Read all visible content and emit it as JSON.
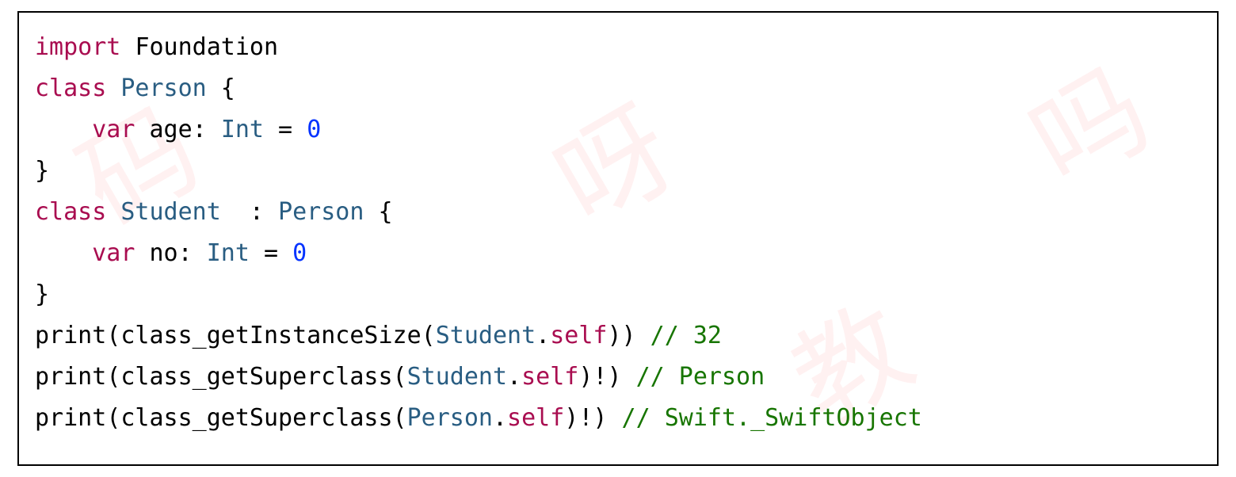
{
  "watermark": {
    "text1": "码",
    "text2": "吗",
    "text3": "呀",
    "text4": "教"
  },
  "code": {
    "line1": {
      "kw": "import",
      "lib": "Foundation"
    },
    "line2": {
      "kw": "class",
      "name": "Person",
      "brace": " {"
    },
    "line3": {
      "indent": "    ",
      "kw": "var",
      "name": "age",
      "colon": ": ",
      "type": "Int",
      "eq": " = ",
      "val": "0"
    },
    "line4": {
      "brace": "}"
    },
    "line5": {
      "kw": "class",
      "name": "Student",
      "sep": "  : ",
      "base": "Person",
      "brace": " {"
    },
    "line6": {
      "indent": "    ",
      "kw": "var",
      "name": "no",
      "colon": ": ",
      "type": "Int",
      "eq": " = ",
      "val": "0"
    },
    "line7": {
      "brace": "}"
    },
    "line8": {
      "fn1": "print",
      "p1": "(",
      "fn2": "class_getInstanceSize",
      "p2": "(",
      "cls": "Student",
      "dot": ".",
      "self": "self",
      "p3": "))",
      "sp": " ",
      "comment": "// 32"
    },
    "line9": {
      "fn1": "print",
      "p1": "(",
      "fn2": "class_getSuperclass",
      "p2": "(",
      "cls": "Student",
      "dot": ".",
      "self": "self",
      "p3": ")!)",
      "sp": " ",
      "comment": "// Person"
    },
    "line10": {
      "fn1": "print",
      "p1": "(",
      "fn2": "class_getSuperclass",
      "p2": "(",
      "cls": "Person",
      "dot": ".",
      "self": "self",
      "p3": ")!)",
      "sp": " ",
      "comment": "// Swift._SwiftObject"
    }
  }
}
